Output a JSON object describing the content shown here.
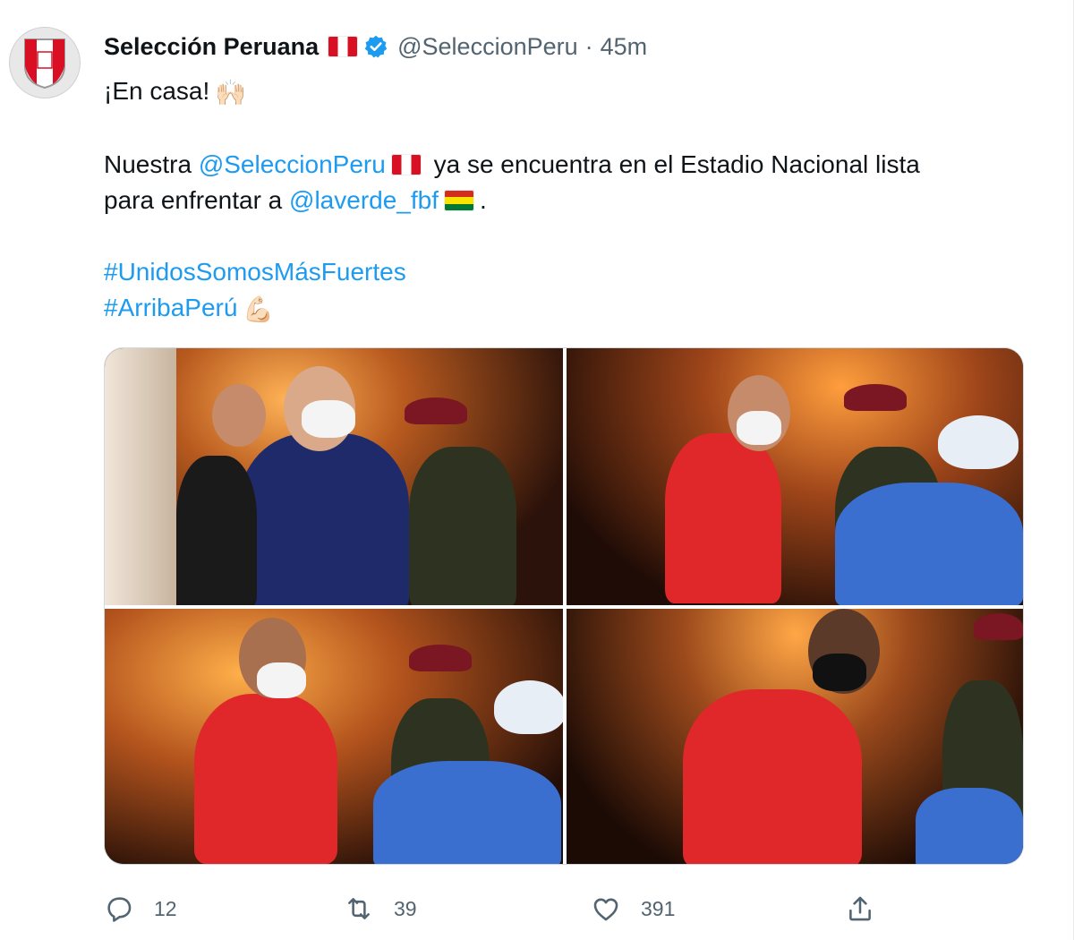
{
  "tweet": {
    "author_name": "Selección Peruana",
    "handle": "@SeleccionPeru",
    "separator": "·",
    "time": "45m",
    "line1": "¡En casa!",
    "line1_emoji": "🙌🏻",
    "line2_before": "Nuestra ",
    "line2_mention": "@SeleccionPeru",
    "line2_after": " ya se encuentra en el Estadio Nacional lista",
    "line3_before": "para enfrentar a ",
    "line3_mention": "@laverde_fbf",
    "line3_after": ".",
    "hashtag1": "#UnidosSomosMásFuertes",
    "hashtag2": "#ArribaPerú",
    "hashtag2_emoji": "💪🏻"
  },
  "actions": {
    "reply_count": "12",
    "retweet_count": "39",
    "like_count": "391"
  },
  "icons": {
    "verified": "verified-badge-icon",
    "reply": "reply-icon",
    "retweet": "retweet-icon",
    "like": "heart-icon",
    "share": "share-icon"
  },
  "colors": {
    "link": "#1d9bf0",
    "muted": "#536471",
    "peru_red": "#d91023"
  }
}
